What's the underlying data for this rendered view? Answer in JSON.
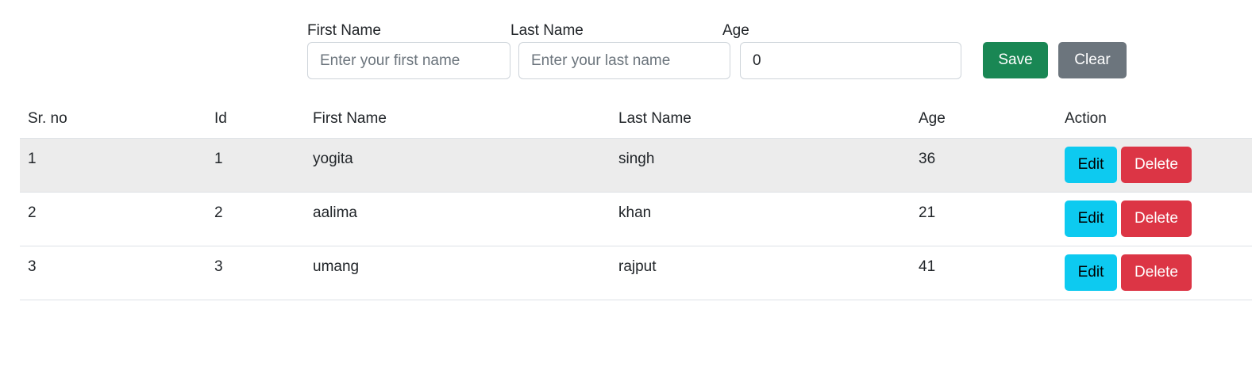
{
  "form": {
    "first_name_label": "First Name",
    "first_name_placeholder": "Enter your first name",
    "first_name_value": "",
    "last_name_label": "Last Name",
    "last_name_placeholder": "Enter your last name",
    "last_name_value": "",
    "age_label": "Age",
    "age_value": "0",
    "save_label": "Save",
    "clear_label": "Clear"
  },
  "table": {
    "headers": [
      "Sr. no",
      "Id",
      "First Name",
      "Last Name",
      "Age",
      "Action"
    ],
    "rows": [
      {
        "sr": "1",
        "id": "1",
        "first_name": "yogita",
        "last_name": "singh",
        "age": "36"
      },
      {
        "sr": "2",
        "id": "2",
        "first_name": "aalima",
        "last_name": "khan",
        "age": "21"
      },
      {
        "sr": "3",
        "id": "3",
        "first_name": "umang",
        "last_name": "rajput",
        "age": "41"
      }
    ],
    "edit_label": "Edit",
    "delete_label": "Delete"
  },
  "colors": {
    "save": "#198754",
    "clear": "#6c757d",
    "edit": "#0dcaf0",
    "delete": "#dc3545",
    "striped_row": "#ececec"
  }
}
